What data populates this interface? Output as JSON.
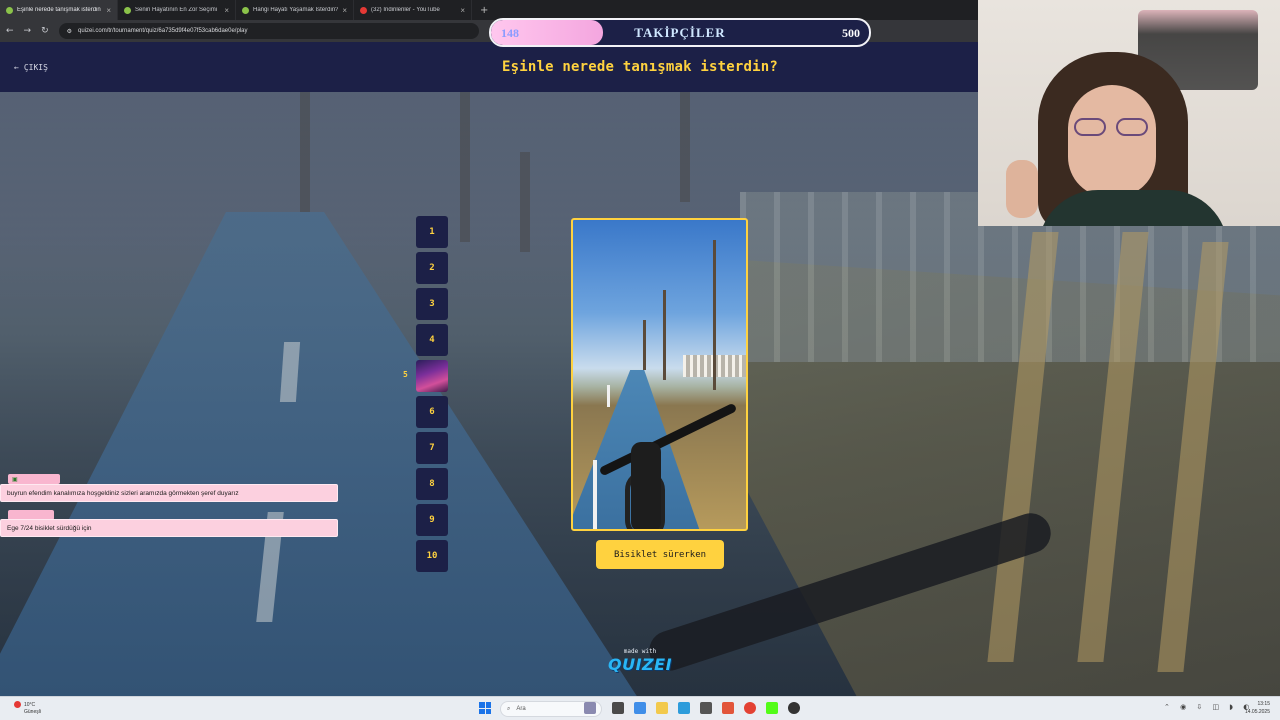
{
  "browser": {
    "tabs": [
      {
        "title": "Eşinle nerede tanışmak isterdin",
        "active": true
      },
      {
        "title": "Senin Hayatının En Zor Seçimi",
        "active": false
      },
      {
        "title": "Hangi Hayatı Yaşamak İsterdin?",
        "active": false
      },
      {
        "title": "(32) İndirilenler - YouTube",
        "active": false
      }
    ],
    "new_tab": "+",
    "url": "quizei.com/tr/tournament/quiz/6a735d9f4e07f53cab6dae0e/play",
    "back_icon": "←",
    "forward_icon": "→",
    "reload_icon": "↻"
  },
  "quiz": {
    "exit_label": "ÇIKIŞ",
    "question": "Eşinle nerede tanışmak isterdin?",
    "answer_label": "Bisiklet sürerken",
    "current_rank": "5",
    "ranks": [
      "1",
      "2",
      "3",
      "4",
      "5",
      "6",
      "7",
      "8",
      "9",
      "10"
    ],
    "made_with": "made with",
    "brand": "QUIZEI"
  },
  "followers": {
    "label": "TAKİPÇİLER",
    "current": "148",
    "goal": "500",
    "progress_fraction": 0.296,
    "fill_color": "#f4a6df"
  },
  "chat": [
    {
      "user": "",
      "message": "buyrun efendim kanalımıza hoşgeldiniz sizleri aramızda görmekten şeref duyarız"
    },
    {
      "user": "",
      "message": "Ege 7/24 bisiklet sürdüğü için"
    }
  ],
  "taskbar": {
    "weather_temp": "10°C",
    "weather_desc": "Güneşli",
    "search_placeholder": "Ara",
    "time": "13:15",
    "date": "14.05.2025"
  },
  "colors": {
    "accent": "#ffd23f",
    "navy": "#1c2047",
    "chat_bg": "#fcd0df"
  }
}
